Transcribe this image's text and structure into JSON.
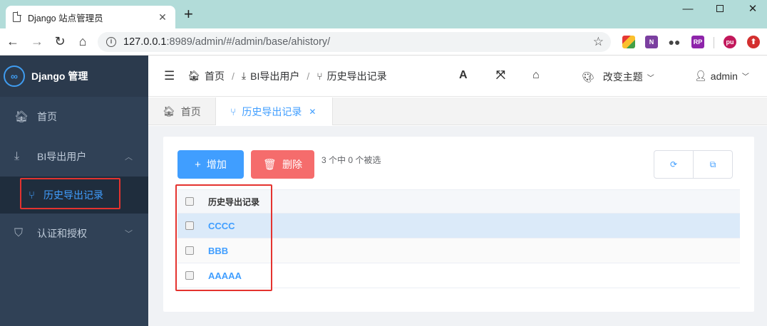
{
  "browser": {
    "tab_title": "Django 站点管理员",
    "tab_close": "✕",
    "new_tab": "+",
    "url_host": "127.0.0.1",
    "url_rest": ":8989/admin/#/admin/base/ahistory/",
    "window_controls": {
      "minimize": "—",
      "close": "✕"
    },
    "extensions": [
      "RP",
      "pu"
    ]
  },
  "sidebar": {
    "brand_title": "Django 管理",
    "items": [
      {
        "label": "首页",
        "icon": "home-icon"
      },
      {
        "label": "BI导出用户",
        "icon": "download-icon",
        "expanded": true,
        "children": [
          {
            "label": "历史导出记录",
            "icon": "branch-icon",
            "active": true
          }
        ]
      },
      {
        "label": "认证和授权",
        "icon": "shield-icon",
        "expanded": false
      }
    ]
  },
  "header": {
    "breadcrumb": [
      "首页",
      "BI导出用户",
      "历史导出记录"
    ],
    "font_icon": "A",
    "theme_label": "改变主题",
    "user": "admin"
  },
  "tabs": [
    {
      "label": "首页",
      "icon": "home-icon"
    },
    {
      "label": "历史导出记录",
      "icon": "branch-icon",
      "active": true,
      "closable": true
    }
  ],
  "toolbar": {
    "add_label": "增加",
    "delete_label": "删除",
    "selection_info": "3 个中 0 个被选"
  },
  "table": {
    "header": "历史导出记录",
    "rows": [
      "CCCC",
      "BBB",
      "AAAAA"
    ],
    "highlighted_row": 0
  },
  "colors": {
    "primary": "#409eff",
    "danger": "#f56c6c",
    "sidebar_bg": "#304156",
    "highlight_box": "#e4332f"
  }
}
